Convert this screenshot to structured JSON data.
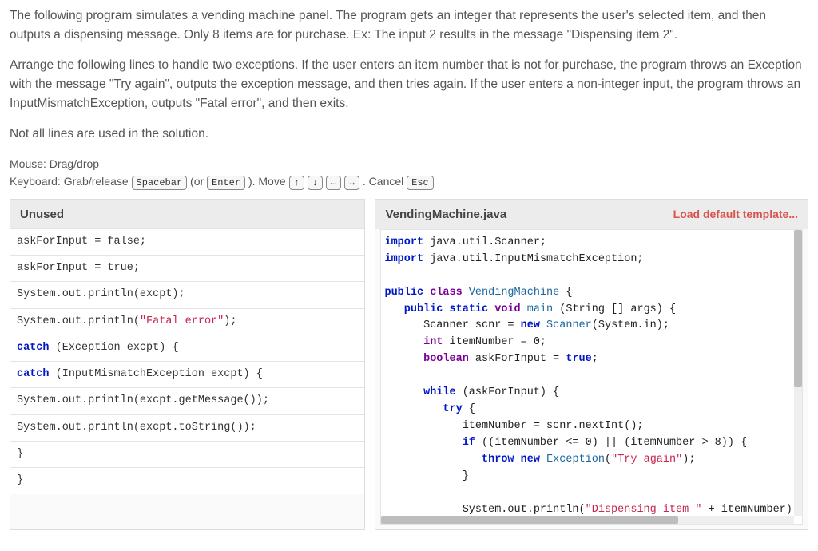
{
  "instructions": {
    "p1": "The following program simulates a vending machine panel. The program gets an integer that represents the user's selected item, and then outputs a dispensing message. Only 8 items are for purchase. Ex: The input 2 results in the message \"Dispensing item 2\".",
    "p2": "Arrange the following lines to handle two exceptions. If the user enters an item number that is not for purchase, the program throws an Exception with the message \"Try again\", outputs the exception message, and then tries again. If the user enters a non-integer input, the program throws an InputMismatchException, outputs \"Fatal error\", and then exits.",
    "p3": "Not all lines are used in the solution."
  },
  "controls": {
    "line1": "Mouse: Drag/drop",
    "line2_pre": "Keyboard: Grab/release ",
    "spacebar": "Spacebar",
    "or": " (or ",
    "enter": "Enter",
    "close_or": "). Move ",
    "up": "↑",
    "down": "↓",
    "left": "←",
    "right": "→",
    "cancel": ". Cancel ",
    "esc": "Esc"
  },
  "unused": {
    "title": "Unused",
    "blocks": [
      {
        "text": "askForInput = false;"
      },
      {
        "text": "askForInput = true;"
      },
      {
        "text": "System.out.println(excpt);"
      },
      {
        "html": "System.out.println(<span class=\"str\">\"Fatal error\"</span>);"
      },
      {
        "html": "<span class=\"kw\">catch</span> (Exception excpt) {"
      },
      {
        "html": "<span class=\"kw\">catch</span> (InputMismatchException excpt) {"
      },
      {
        "text": "System.out.println(excpt.getMessage());"
      },
      {
        "text": "System.out.println(excpt.toString());"
      },
      {
        "text": "}"
      },
      {
        "text": "}"
      }
    ]
  },
  "editor": {
    "filename": "VendingMachine.java",
    "load_template": "Load default template...",
    "code_html": "<span class=\"kw\">import</span> java.util.Scanner;\n<span class=\"kw\">import</span> java.util.InputMismatchException;\n\n<span class=\"kw\">public</span> <span class=\"typekw\">class</span> <span class=\"cls\">VendingMachine</span> {\n   <span class=\"kw\">public</span> <span class=\"kw\">static</span> <span class=\"typekw\">void</span> <span class=\"cls\">main</span> (String [] args) {\n      Scanner scnr = <span class=\"kw\">new</span> <span class=\"cls\">Scanner</span>(System.in);\n      <span class=\"typekw\">int</span> itemNumber = 0;\n      <span class=\"typekw\">boolean</span> askForInput = <span class=\"kw\">true</span>;\n\n      <span class=\"kw\">while</span> (askForInput) {\n         <span class=\"kw\">try</span> {\n            itemNumber = scnr.nextInt();\n            <span class=\"kw\">if</span> ((itemNumber &lt;= 0) || (itemNumber &gt; 8)) {\n               <span class=\"kw\">throw</span> <span class=\"kw\">new</span> <span class=\"cls\">Exception</span>(<span class=\"str\">\"Try again\"</span>);\n            }\n\n            System.out.println(<span class=\"str\">\"Dispensing item \"</span> + itemNumber);\n            askForInput = <span class=\"kw\">false</span>;"
  }
}
